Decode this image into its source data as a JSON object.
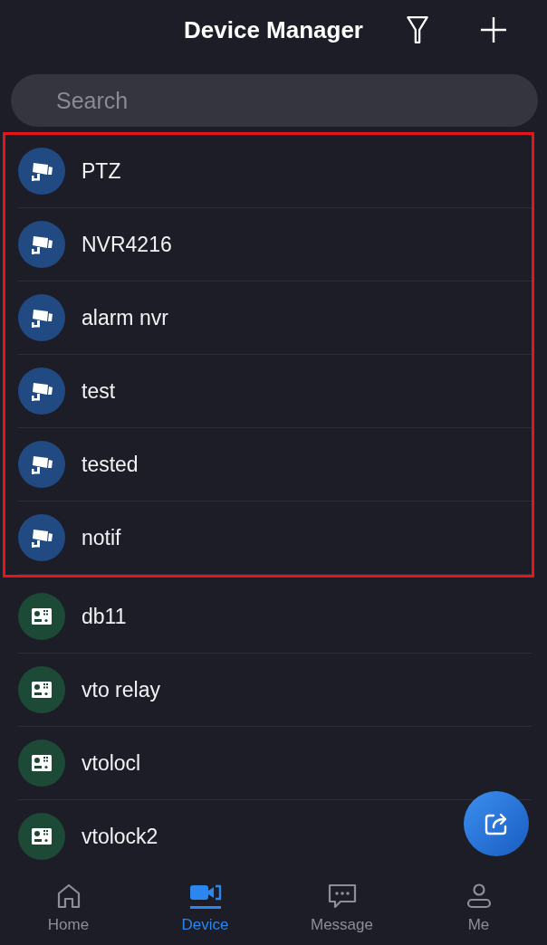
{
  "header": {
    "title": "Device Manager"
  },
  "search": {
    "placeholder": "Search"
  },
  "devices": [
    {
      "name": "PTZ",
      "kind": "camera",
      "highlighted": true
    },
    {
      "name": "NVR4216",
      "kind": "camera",
      "highlighted": true
    },
    {
      "name": "alarm nvr",
      "kind": "camera",
      "highlighted": true
    },
    {
      "name": "test",
      "kind": "camera",
      "highlighted": true
    },
    {
      "name": "tested",
      "kind": "camera",
      "highlighted": true
    },
    {
      "name": "notif",
      "kind": "camera",
      "highlighted": true
    },
    {
      "name": "db11",
      "kind": "intercom",
      "highlighted": false
    },
    {
      "name": "vto relay",
      "kind": "intercom",
      "highlighted": false
    },
    {
      "name": "vtolocl",
      "kind": "intercom",
      "highlighted": false
    },
    {
      "name": "vtolock2",
      "kind": "intercom",
      "highlighted": false
    }
  ],
  "tabs": [
    {
      "label": "Home",
      "kind": "home",
      "selected": false
    },
    {
      "label": "Device",
      "kind": "device",
      "selected": true
    },
    {
      "label": "Message",
      "kind": "message",
      "selected": false
    },
    {
      "label": "Me",
      "kind": "me",
      "selected": false
    }
  ]
}
